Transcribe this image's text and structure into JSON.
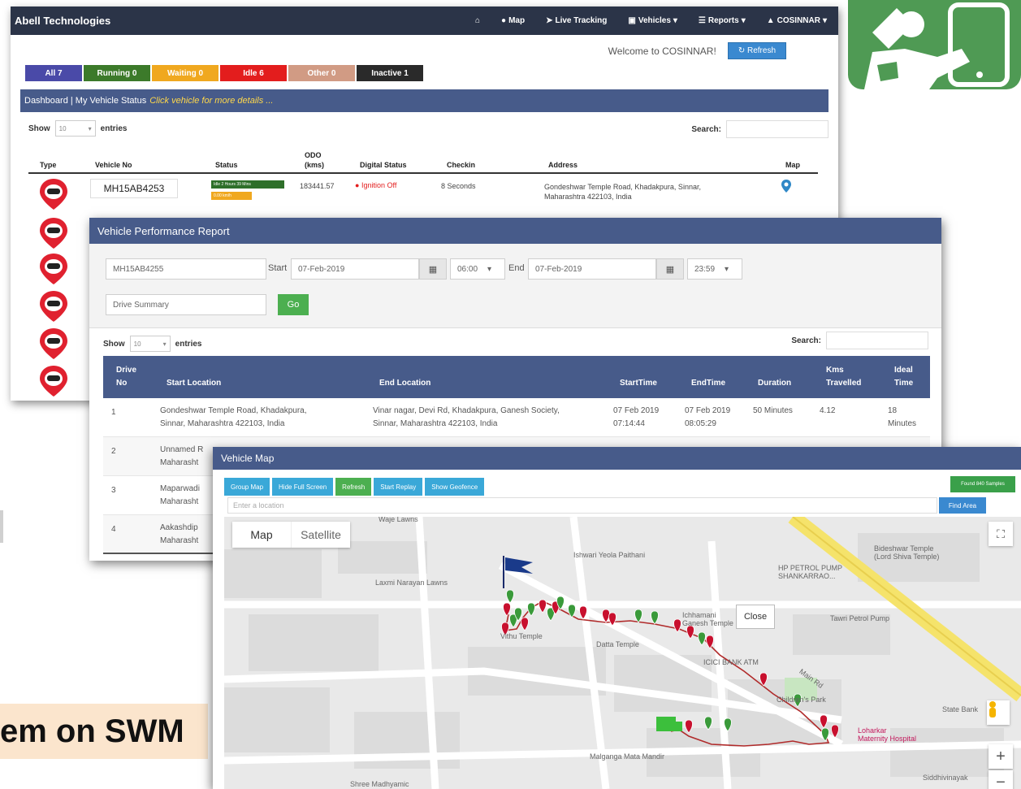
{
  "caption": {
    "text": "em on SWM"
  },
  "dashboard": {
    "brand": "Abell Technologies",
    "nav": {
      "map": "Map",
      "tracking": "Live Tracking",
      "vehicles": "Vehicles",
      "reports": "Reports",
      "user": "COSINNAR"
    },
    "welcome": "Welcome to COSINNAR!",
    "refresh_label": "Refresh",
    "badges": [
      {
        "label": "All 7",
        "color": "#4a4aa8"
      },
      {
        "label": "Running 0",
        "color": "#3c7a2a"
      },
      {
        "label": "Waiting 0",
        "color": "#f0a81f"
      },
      {
        "label": "Idle 6",
        "color": "#e31d1d"
      },
      {
        "label": "Other 0",
        "color": "#d19b84"
      },
      {
        "label": "Inactive 1",
        "color": "#2a2a2a"
      }
    ],
    "panel_title": "Dashboard | My Vehicle Status",
    "panel_hint": "Click vehicle for more details ...",
    "show_label": "Show",
    "show_value": "10",
    "entries_label": "entries",
    "search_label": "Search:",
    "columns": {
      "type": "Type",
      "vehicle": "Vehicle No",
      "status": "Status",
      "odo1": "ODO",
      "odo2": "(kms)",
      "digital": "Digital Status",
      "checkin": "Checkin",
      "address": "Address",
      "map": "Map"
    },
    "row": {
      "vehicle_no": "MH15AB4253",
      "status_idle": "Idle 2 Hours 39 Mins",
      "status_speed": "0.00 km/h",
      "odo": "183441.57",
      "digital": "Ignition Off",
      "checkin": "8 Seconds",
      "address_l1": "Gondeshwar Temple Road, Khadakpura, Sinnar,",
      "address_l2": "Maharashtra 422103, India"
    }
  },
  "report": {
    "title": "Vehicle Performance Report",
    "vehicle": "MH15AB4255",
    "start_label": "Start",
    "start_date": "07-Feb-2019",
    "start_time": "06:00",
    "end_label": "End",
    "end_date": "07-Feb-2019",
    "end_time": "23:59",
    "report_type": "Drive Summary",
    "go": "Go",
    "show_label": "Show",
    "show_value": "10",
    "entries_label": "entries",
    "search_label": "Search:",
    "columns": {
      "drive1": "Drive",
      "drive2": "No",
      "start": "Start Location",
      "end": "End Location",
      "starttime": "StartTime",
      "endtime": "EndTime",
      "duration": "Duration",
      "kms1": "Kms",
      "kms2": "Travelled",
      "ideal1": "Ideal",
      "ideal2": "Time"
    },
    "rows": [
      {
        "no": "1",
        "start_l1": "Gondeshwar Temple Road, Khadakpura,",
        "start_l2": "Sinnar, Maharashtra 422103, India",
        "end_l1": "Vinar nagar, Devi Rd, Khadakpura, Ganesh Society,",
        "end_l2": "Sinnar, Maharashtra 422103, India",
        "st1": "07 Feb 2019",
        "st2": "07:14:44",
        "et1": "07 Feb 2019",
        "et2": "08:05:29",
        "duration": "50 Minutes",
        "kms": "4.12",
        "ideal1": "18",
        "ideal2": "Minutes"
      },
      {
        "no": "2",
        "start_l1": "Unnamed R",
        "start_l2": "Maharasht"
      },
      {
        "no": "3",
        "start_l1": "Maparwadi",
        "start_l2": "Maharasht"
      },
      {
        "no": "4",
        "start_l1": "Aakashdip",
        "start_l2": "Maharasht"
      }
    ]
  },
  "vmap": {
    "title": "Vehicle Map",
    "buttons": [
      {
        "label": "Group Map",
        "color": "#3aa8d8"
      },
      {
        "label": "Hide Full Screen",
        "color": "#3aa8d8"
      },
      {
        "label": "Refresh",
        "color": "#4caf50"
      },
      {
        "label": "Start Replay",
        "color": "#3aa8d8"
      },
      {
        "label": "Show Geofence",
        "color": "#3aa8d8"
      }
    ],
    "found_samples": "Found 840 Samples",
    "location_placeholder": "Enter a location",
    "find_area": "Find Area",
    "map_tab": "Map",
    "satellite_tab": "Satellite",
    "close": "Close",
    "places": {
      "wajelawns": "Waje Lawns",
      "ishwari": "Ishwari Yeola Paithani",
      "laxmi": "Laxmi Narayan Lawns",
      "bideshwar1": "Bideshwar Temple",
      "bideshwar2": "(Lord Shiva Temple)",
      "hppetrol1": "HP PETROL PUMP",
      "hppetrol2": "SHANKARRAO...",
      "ichhamani1": "Ichhamani",
      "ichhamani2": "Ganesh Temple",
      "tawri": "Tawri Petrol Pump",
      "vithu": "Vithu Temple",
      "datta": "Datta Temple",
      "icici": "ICICI BANK ATM",
      "children": "Children's Park",
      "statebank": "State Bank",
      "loharkar1": "Loharkar",
      "loharkar2": "Maternity Hospital",
      "malganga": "Malganga Mata Mandir",
      "shreemadhyamic": "Shree Madhyamic",
      "siddhivinayak": "Siddhivinayak",
      "main_rd": "Main Rd"
    }
  }
}
